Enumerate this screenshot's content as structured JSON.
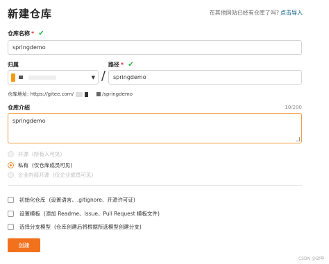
{
  "header": {
    "title": "新建仓库",
    "import_hint": "在其他网站已经有仓库了吗?",
    "import_link": "点击导入"
  },
  "repo_name": {
    "label": "仓库名称",
    "required_mark": "*",
    "valid_icon": "check-icon",
    "value": "springdemo"
  },
  "owner": {
    "label": "归属",
    "dropdown_icon": "caret-down-icon"
  },
  "path": {
    "label": "路径",
    "required_mark": "*",
    "separator": "/",
    "value": "springdemo"
  },
  "repo_url": {
    "prefix": "仓库地址: https://gitee.com/",
    "suffix": "/springdemo"
  },
  "description": {
    "label": "仓库介绍",
    "counter": "10/200",
    "value": "springdemo"
  },
  "visibility": {
    "options": [
      {
        "label": "开源",
        "note": "(所有人可见)",
        "selected": false,
        "disabled": true
      },
      {
        "label": "私有",
        "note": "(仅仓库成员可见)",
        "selected": true,
        "disabled": false
      },
      {
        "label": "企业内部开源",
        "note": "(仅企业成员可见)",
        "selected": false,
        "disabled": true
      }
    ]
  },
  "options": {
    "init_repo": {
      "label": "初始化仓库",
      "note": "(设置语言、.gitignore、开源许可证)",
      "checked": false
    },
    "template": {
      "label": "设置模板",
      "note": "(添加 Readme、Issue、Pull Request 模板文件)",
      "checked": false
    },
    "branch_model": {
      "label": "选择分支模型",
      "note": "(仓库创建后将根据所选模型创建分支)",
      "checked": false
    }
  },
  "create_button": "创建",
  "watermark": "CSDN @战神",
  "colors": {
    "accent": "#f2711c",
    "valid": "#21ba45",
    "required": "#db2828",
    "link": "#005980"
  }
}
